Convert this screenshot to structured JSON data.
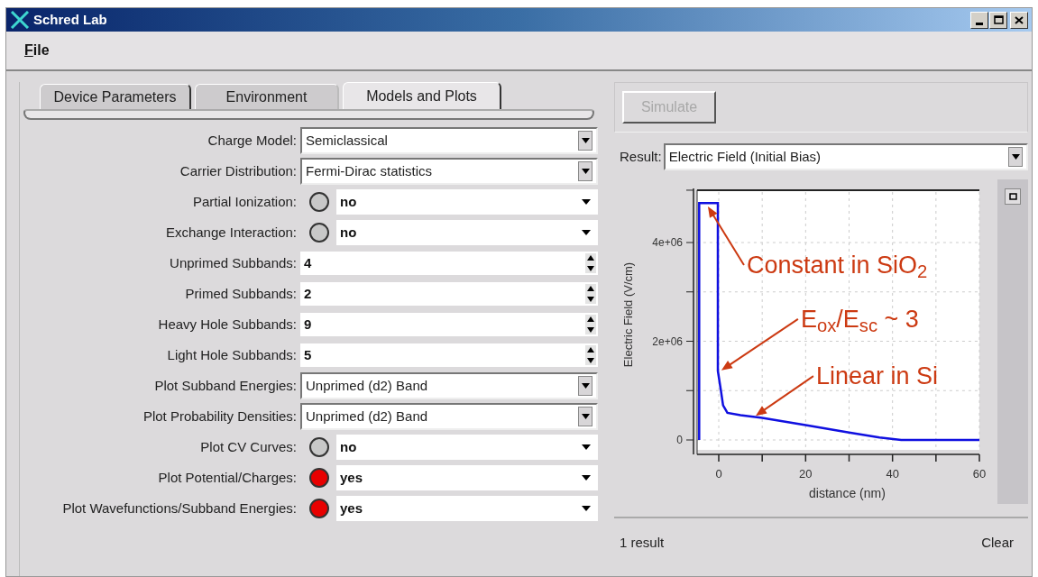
{
  "window": {
    "title": "Schred Lab"
  },
  "menu": [
    {
      "label": "File"
    }
  ],
  "tabs": [
    {
      "label": "Device Parameters",
      "selected": false
    },
    {
      "label": "Environment",
      "selected": false
    },
    {
      "label": "Models and Plots",
      "selected": true
    }
  ],
  "parameters": [
    {
      "kind": "select",
      "label": "Charge Model:",
      "value": "Semiclassical"
    },
    {
      "kind": "select",
      "label": "Carrier Distribution:",
      "value": "Fermi-Dirac statistics"
    },
    {
      "kind": "toggle",
      "label": "Partial Ionization:",
      "on": false,
      "value": "no"
    },
    {
      "kind": "toggle",
      "label": "Exchange Interaction:",
      "on": false,
      "value": "no"
    },
    {
      "kind": "spin",
      "label": "Unprimed Subbands:",
      "value": "4"
    },
    {
      "kind": "spin",
      "label": "Primed Subbands:",
      "value": "2"
    },
    {
      "kind": "spin",
      "label": "Heavy Hole Subbands:",
      "value": "9"
    },
    {
      "kind": "spin",
      "label": "Light Hole Subbands:",
      "value": "5"
    },
    {
      "kind": "select",
      "label": "Plot Subband Energies:",
      "value": "Unprimed (d2) Band"
    },
    {
      "kind": "select",
      "label": "Plot Probability Densities:",
      "value": "Unprimed (d2) Band"
    },
    {
      "kind": "toggle",
      "label": "Plot CV Curves:",
      "on": false,
      "value": "no"
    },
    {
      "kind": "toggle",
      "label": "Plot Potential/Charges:",
      "on": true,
      "value": "yes"
    },
    {
      "kind": "toggle",
      "label": "Plot Wavefunctions/Subband Energies:",
      "on": true,
      "value": "yes"
    }
  ],
  "simulate_button": {
    "label": "Simulate",
    "disabled": true
  },
  "result": {
    "label": "Result:",
    "value": "Electric Field (Initial Bias)"
  },
  "chart_data": {
    "type": "line",
    "xlabel": "distance (nm)",
    "ylabel": "Electric Field (V/cm)",
    "x": [
      -4.5,
      -4.5,
      -0.2,
      -0.2,
      0.5,
      1,
      2,
      5,
      10,
      20,
      30,
      37,
      42,
      60
    ],
    "grid": true,
    "series": [
      {
        "color": "#1010e0",
        "values": [
          0,
          4800000,
          4800000,
          1400000,
          1000000,
          700000,
          550000,
          500000,
          450000,
          300000,
          150000,
          50000,
          0,
          0
        ]
      }
    ],
    "xlim": [
      -5,
      60
    ],
    "ylim": [
      -200000,
      5060000
    ],
    "xticks": [
      0,
      20,
      40,
      60
    ],
    "yticks": [
      {
        "value": 0,
        "label": "0"
      },
      {
        "value": 2000000,
        "label": "2e+06"
      },
      {
        "value": 4000000,
        "label": "4e+06"
      }
    ],
    "annotations": [
      {
        "text": "Constant in SiO$_{2}$",
        "x": -2.5,
        "y": 4730000
      },
      {
        "text": "E$_{ox}$/E$_{sc}$ ~ 3",
        "x": 0.6,
        "y": 1410000
      },
      {
        "text": "Linear in Si",
        "x": 8.5,
        "y": 490000
      }
    ]
  },
  "status": {
    "count": "1 result",
    "clear": "Clear"
  }
}
